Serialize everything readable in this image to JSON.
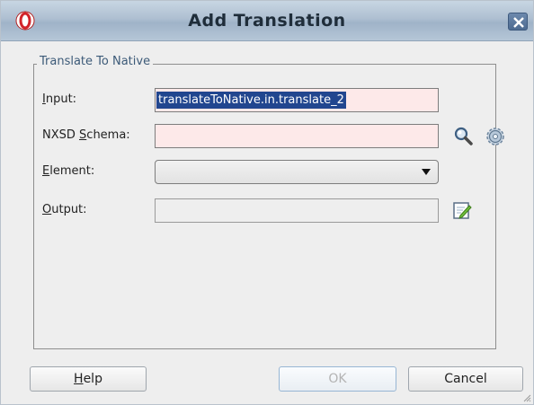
{
  "window": {
    "title": "Add Translation"
  },
  "group": {
    "legend": "Translate To Native"
  },
  "fields": {
    "input": {
      "label_mnemonic": "I",
      "label_rest": "nput:",
      "value": "translateToNative.in.translate_2"
    },
    "schema": {
      "label_pre": "NXSD ",
      "label_mnemonic": "S",
      "label_rest": "chema:",
      "value": ""
    },
    "element": {
      "label_mnemonic": "E",
      "label_rest": "lement:",
      "value": ""
    },
    "output": {
      "label_mnemonic": "O",
      "label_rest": "utput:",
      "value": ""
    }
  },
  "buttons": {
    "help_mnemonic": "H",
    "help_rest": "elp",
    "ok": "OK",
    "cancel": "Cancel"
  },
  "icons": {
    "app": "oracle-app-icon",
    "close": "close-icon",
    "search": "search-icon",
    "settings": "gear-icon",
    "edit": "edit-icon",
    "dropdown": "chevron-down-icon"
  }
}
